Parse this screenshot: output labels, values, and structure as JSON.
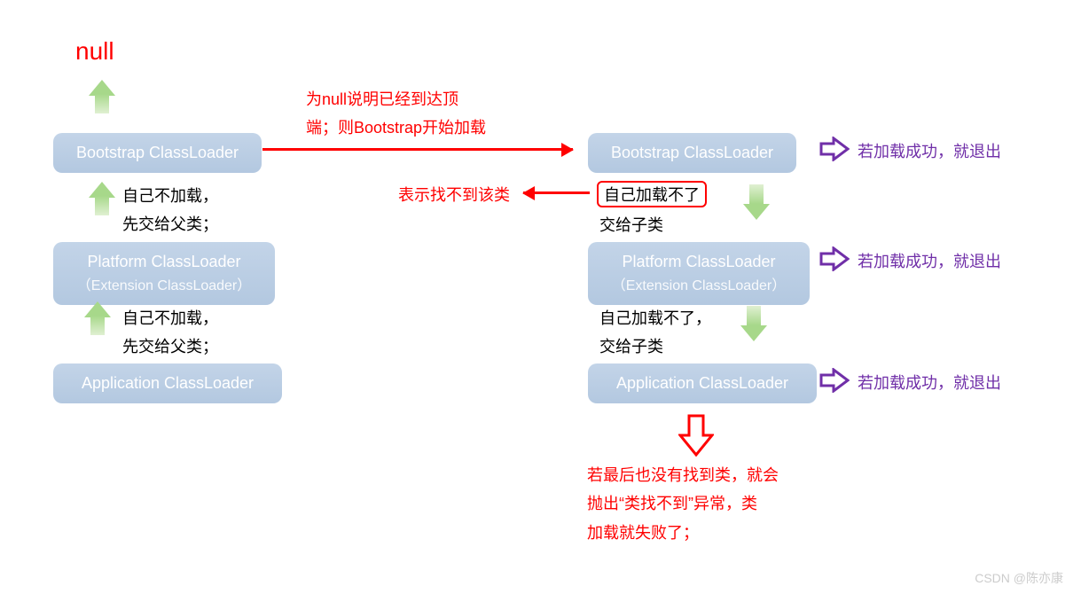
{
  "top": {
    "null_label": "null"
  },
  "left": {
    "bootstrap": "Bootstrap ClassLoader",
    "platform": "Platform ClassLoader",
    "platform_sub": "（Extension ClassLoader）",
    "application": "Application ClassLoader",
    "text1_line1": "自己不加载，",
    "text1_line2": "先交给父类；",
    "text2_line1": "自己不加载，",
    "text2_line2": "先交给父类；"
  },
  "center": {
    "arrow_right_note_line1": "为null说明已经到达顶",
    "arrow_right_note_line2": "端；则Bootstrap开始加载",
    "arrow_left_note": "表示找不到该类"
  },
  "right": {
    "bootstrap": "Bootstrap ClassLoader",
    "platform": "Platform ClassLoader",
    "platform_sub": "（Extension ClassLoader）",
    "application": "Application ClassLoader",
    "fail1": "自己加载不了",
    "fail1_sub": "交给子类",
    "fail2_line1": "自己加载不了，",
    "fail2_line2": "交给子类"
  },
  "purple": {
    "success1": "若加载成功，就退出",
    "success2": "若加载成功，就退出",
    "success3": "若加载成功，就退出"
  },
  "bottom": {
    "line1": "若最后也没有找到类，就会",
    "line2": "抛出“类找不到”异常，类",
    "line3": "加载就失败了；"
  },
  "watermark": "CSDN @陈亦康"
}
